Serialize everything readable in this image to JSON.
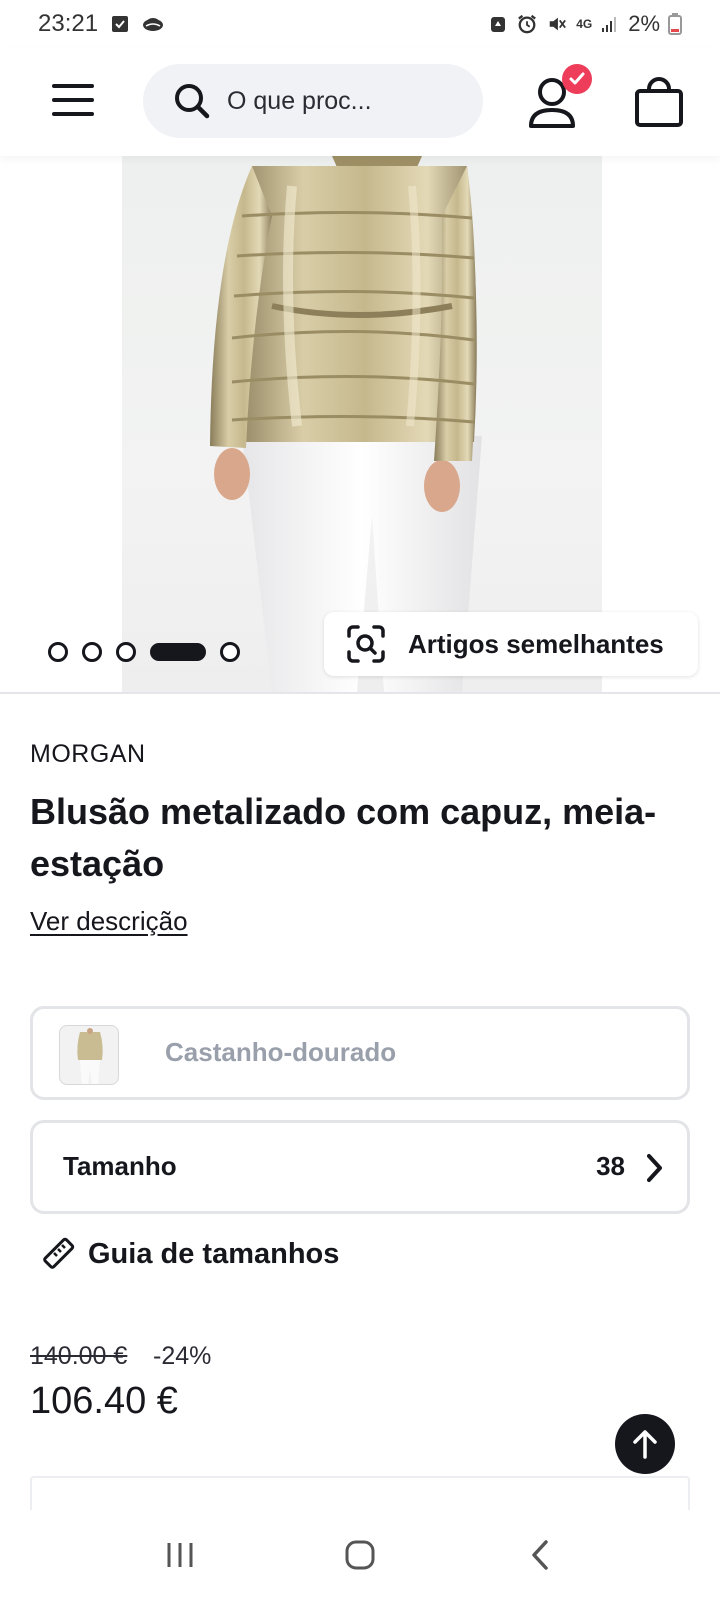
{
  "status_bar": {
    "time": "23:21",
    "battery": "2%",
    "network": "4G"
  },
  "header": {
    "search_placeholder": "O que proc...",
    "icons": [
      "menu-icon",
      "search-icon",
      "account-icon",
      "check-icon",
      "shopping-bag-icon"
    ],
    "badge_color": "#ee3d5a"
  },
  "gallery": {
    "image_count": 5,
    "active_index": 3,
    "similar_label": "Artigos semelhantes"
  },
  "product": {
    "brand": "MORGAN",
    "title": "Blusão metalizado com capuz, meia-estação",
    "description_link": "Ver descrição",
    "color": "Castanho-dourado",
    "size_label": "Tamanho",
    "size_value": "38",
    "size_guide": "Guia de tamanhos",
    "old_price": "140.00 €",
    "discount": "-24%",
    "price": "106.40 €"
  },
  "colors": {
    "text": "#16161d",
    "muted": "#9aa0ab",
    "search_bg": "#f1f2f6"
  }
}
